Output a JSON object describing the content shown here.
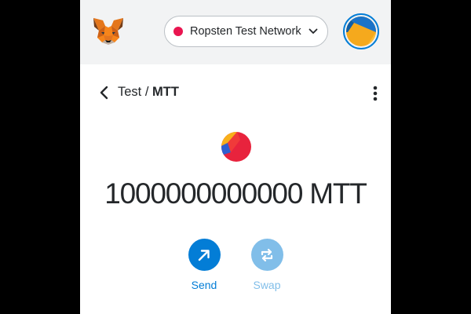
{
  "header": {
    "network": {
      "label": "Ropsten Test Network",
      "dot_color": "#e91550"
    },
    "logo_icon": "metamask-fox-icon",
    "account_icon": "account-identicon"
  },
  "asset_nav": {
    "account_name": "Test",
    "separator": " / ",
    "token_symbol": "MTT",
    "back_icon": "chevron-left-icon",
    "menu_icon": "kebab-menu-icon"
  },
  "asset": {
    "icon": "token-identicon",
    "balance": "1000000000000 MTT"
  },
  "actions": {
    "send": {
      "label": "Send",
      "icon": "arrow-up-right-icon",
      "enabled": true
    },
    "swap": {
      "label": "Swap",
      "icon": "swap-arrows-icon",
      "enabled": false
    }
  },
  "colors": {
    "primary": "#037dd6",
    "primary_disabled": "#81bee9",
    "header_bg": "#f2f3f4",
    "text": "#24272a"
  }
}
